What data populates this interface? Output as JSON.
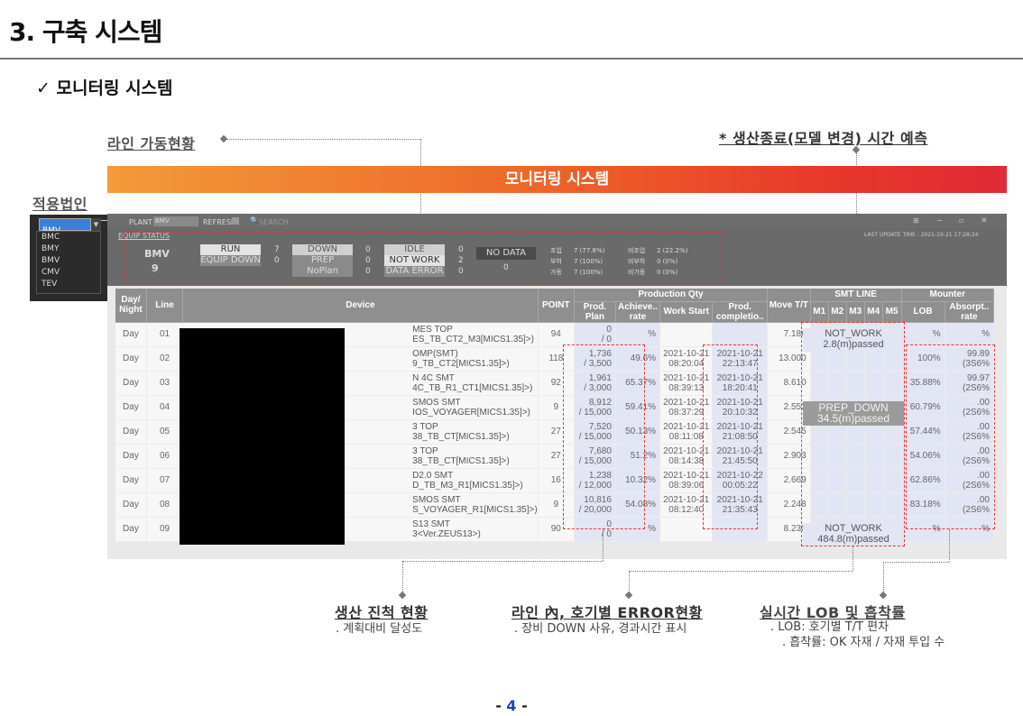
{
  "slide": {
    "title": "3. 구축 시스템",
    "subtitle": "✓  모니터링 시스템",
    "page_prefix": "- ",
    "page_number": "4",
    "page_suffix": " -"
  },
  "callouts": {
    "line_status": "라인 가동현황",
    "prediction": "* 생산종료(모델 변경) 시간 예측",
    "plant_label": "적용법인",
    "progress_title": "생산 진척 현황",
    "progress_sub": ". 계획대비 달성도",
    "error_title": "라인 內, 호기별 ERROR현황",
    "error_sub": ". 장비 DOWN 사유, 경과시간 표시",
    "lob_title": "실시간 LOB 및 흡착률",
    "lob_sub1": ". LOB: 호기별 T/T 편차",
    "lob_sub2": ". 흡착률: OK 자재 / 자재 투입 수"
  },
  "banner": {
    "text": "모니터링 시스템"
  },
  "plant_dropdown": {
    "items": [
      "BMV",
      "BMC",
      "BMY",
      "BMV",
      "CMV",
      "TEV"
    ],
    "selected": "BMV"
  },
  "app": {
    "plant_label": "PLANT",
    "plant_value": "BMV",
    "refresh_label": "REFRESH",
    "search_placeholder": "SEARCH",
    "status_tab": "EQUIP STATUS",
    "last_update": "LAST UPDATE TIME : 2021-10-21 17:28:24",
    "plant_code": "BMV",
    "plant_count": "9",
    "status": {
      "run": "RUN",
      "run_count": "7",
      "equip_down": "EQUIP DOWN",
      "equip_down_count": "0",
      "down": "DOWN",
      "down_count": "0",
      "prep": "PREP",
      "prep_count": "0",
      "noplan": "NoPlan",
      "noplan_count": "0",
      "idle": "IDLE",
      "idle_count": "0",
      "not_work": "NOT WORK",
      "not_work_count": "2",
      "data_error": "DATA ERROR",
      "data_error_count": "0",
      "no_data": "NO DATA",
      "no_data_count": "0"
    },
    "stats": [
      {
        "label": "조업",
        "value": "7 (77.8%)",
        "label2": "비조업",
        "value2": "2 (22.2%)"
      },
      {
        "label": "부하",
        "value": "7 (100%)",
        "label2": "비부하",
        "value2": "0 (0%)"
      },
      {
        "label": "가동",
        "value": "7 (100%)",
        "label2": "비가동",
        "value2": "0 (0%)"
      }
    ]
  },
  "table": {
    "headers": {
      "day_night": "Day/ Night",
      "line": "Line",
      "device": "Device",
      "point": "POINT",
      "production_qty": "Production Qty",
      "prod_plan": "Prod. Plan",
      "achieve_rate": "Achieve.. rate",
      "work_start": "Work Start",
      "prod_completion": "Prod. completio..",
      "move_tt": "Move T/T",
      "smt_line": "SMT LINE",
      "m1": "M1",
      "m2": "M2",
      "m3": "M3",
      "m4": "M4",
      "m5": "M5",
      "mounter": "Mounter",
      "lob": "LOB",
      "absorpt_rate": "Absorpt.. rate"
    },
    "rows": [
      {
        "dn": "Day",
        "line": "01",
        "dev1": "MES TOP",
        "dev2": "ES_TB_CT2_M3[MICS1.35]>)",
        "point": "94",
        "plan1": "0",
        "plan2": "/ 0",
        "rate": "%",
        "start1": "",
        "start2": "",
        "comp1": "",
        "comp2": "",
        "tt": "7.186",
        "lob": "%",
        "abs1": "%",
        "abs2": ""
      },
      {
        "dn": "Day",
        "line": "02",
        "dev1": "OMP(SMT)",
        "dev2": "9_TB_CT2[MICS1.35]>)",
        "point": "118",
        "plan1": "1,736",
        "plan2": "/ 3,500",
        "rate": "49.6%",
        "start1": "2021-10-21",
        "start2": "08:20:04",
        "comp1": "2021-10-21",
        "comp2": "22:13:47",
        "tt": "13.000",
        "lob": "100%",
        "abs1": "99.89",
        "abs2": "(3S6%"
      },
      {
        "dn": "Day",
        "line": "03",
        "dev1": "N 4C SMT",
        "dev2": "4C_TB_R1_CT1[MICS1.35]>)",
        "point": "92",
        "plan1": "1,961",
        "plan2": "/ 3,000",
        "rate": "65.37%",
        "start1": "2021-10-21",
        "start2": "08:39:13",
        "comp1": "2021-10-21",
        "comp2": "18:20:41",
        "tt": "8.610",
        "lob": "35.88%",
        "abs1": "99.97",
        "abs2": "(2S6%"
      },
      {
        "dn": "Day",
        "line": "04",
        "dev1": "SMOS SMT",
        "dev2": "IOS_VOYAGER[MICS1.35]>)",
        "point": "9",
        "plan1": "8,912",
        "plan2": "/ 15,000",
        "rate": "59.41%",
        "start1": "2021-10-21",
        "start2": "08:37:29",
        "comp1": "2021-10-21",
        "comp2": "20:10:32",
        "tt": "2.552",
        "lob": "60.79%",
        "abs1": ".00",
        "abs2": "(2S6%"
      },
      {
        "dn": "Day",
        "line": "05",
        "dev1": "3 TOP",
        "dev2": "38_TB_CT[MICS1.35]>)",
        "point": "27",
        "plan1": "7,520",
        "plan2": "/ 15,000",
        "rate": "50.13%",
        "start1": "2021-10-21",
        "start2": "08:11:08",
        "comp1": "2021-10-21",
        "comp2": "21:08:50",
        "tt": "2.545",
        "lob": "57.44%",
        "abs1": ".00",
        "abs2": "(2S6%"
      },
      {
        "dn": "Day",
        "line": "06",
        "dev1": "3 TOP",
        "dev2": "38_TB_CT[MICS1.35]>)",
        "point": "27",
        "plan1": "7,680",
        "plan2": "/ 15,000",
        "rate": "51.2%",
        "start1": "2021-10-21",
        "start2": "08:14:38",
        "comp1": "2021-10-21",
        "comp2": "21:45:50",
        "tt": "2.903",
        "lob": "54.06%",
        "abs1": ".00",
        "abs2": "(2S6%"
      },
      {
        "dn": "Day",
        "line": "07",
        "dev1": "D2.0 SMT",
        "dev2": "D_TB_M3_R1[MICS1.35]>)",
        "point": "16",
        "plan1": "1,238",
        "plan2": "/ 12,000",
        "rate": "10.32%",
        "start1": "2021-10-21",
        "start2": "08:39:06",
        "comp1": "2021-10-22",
        "comp2": "00:05:22",
        "tt": "2.669",
        "lob": "62.86%",
        "abs1": ".00",
        "abs2": "(2S6%"
      },
      {
        "dn": "Day",
        "line": "08",
        "dev1": "SMOS SMT",
        "dev2": "S_VOYAGER_R1[MICS1.35]>)",
        "point": "9",
        "plan1": "10,816",
        "plan2": "/ 20,000",
        "rate": "54.08%",
        "start1": "2021-10-21",
        "start2": "08:12:40",
        "comp1": "2021-10-21",
        "comp2": "21:35:43",
        "tt": "2.248",
        "lob": "83.18%",
        "abs1": ".00",
        "abs2": "(2S6%"
      },
      {
        "dn": "Day",
        "line": "09",
        "dev1": "S13 SMT",
        "dev2": "3<Ver.ZEUS13>)",
        "point": "90",
        "plan1": "0",
        "plan2": "/ 0",
        "rate": "%",
        "start1": "",
        "start2": "",
        "comp1": "",
        "comp2": "",
        "tt": "8.230",
        "lob": "%",
        "abs1": "%",
        "abs2": ""
      }
    ],
    "smt_states": {
      "top_state": "NOT_WORK",
      "top_time": "2.8(m)passed",
      "mid_state": "PREP_DOWN",
      "mid_time": "34.5(m)passed",
      "bot_state": "NOT_WORK",
      "bot_time": "484.8(m)passed"
    }
  }
}
